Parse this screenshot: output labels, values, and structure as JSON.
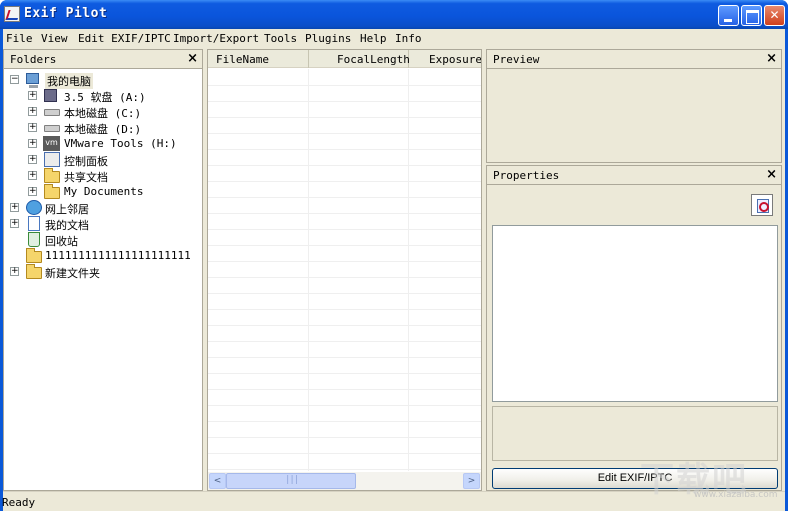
{
  "window": {
    "title": "Exif Pilot"
  },
  "menu": [
    "File",
    "View",
    "Edit EXIF/IPTC",
    "Import/Export",
    "Tools",
    "Plugins",
    "Help",
    "Info"
  ],
  "folders": {
    "title": "Folders",
    "close": "×",
    "tree": [
      {
        "label": "我的电脑",
        "expander": "−",
        "icon": "computer-icon"
      },
      {
        "label": "3.5 软盘 (A:)",
        "expander": "+",
        "icon": "floppy-drive-icon"
      },
      {
        "label": "本地磁盘 (C:)",
        "expander": "+",
        "icon": "hard-drive-icon"
      },
      {
        "label": "本地磁盘 (D:)",
        "expander": "+",
        "icon": "hard-drive-icon"
      },
      {
        "label": "VMware Tools (H:)",
        "expander": "+",
        "icon": "vmware-drive-icon"
      },
      {
        "label": "控制面板",
        "expander": "+",
        "icon": "control-panel-icon"
      },
      {
        "label": "共享文档",
        "expander": "+",
        "icon": "folder-icon"
      },
      {
        "label": "My Documents",
        "expander": "+",
        "icon": "folder-icon"
      },
      {
        "label": "网上邻居",
        "expander": "+",
        "icon": "network-icon"
      },
      {
        "label": "我的文档",
        "expander": "+",
        "icon": "documents-icon"
      },
      {
        "label": "回收站",
        "expander": "",
        "icon": "recycle-bin-icon"
      },
      {
        "label": "1111111111111111111111",
        "expander": "",
        "icon": "folder-icon"
      },
      {
        "label": "新建文件夹",
        "expander": "+",
        "icon": "folder-icon"
      }
    ]
  },
  "file_list": {
    "columns": [
      "FileName",
      "FocalLength",
      "Exposure"
    ],
    "scroll_left": "<",
    "scroll_right": ">"
  },
  "preview": {
    "title": "Preview",
    "close": "×"
  },
  "properties": {
    "title": "Properties",
    "close": "×",
    "edit_button": "Edit EXIF/IPTC"
  },
  "status": {
    "text": "Ready"
  },
  "watermark": {
    "big": "下载吧",
    "small": "www.xiazaiba.com"
  }
}
